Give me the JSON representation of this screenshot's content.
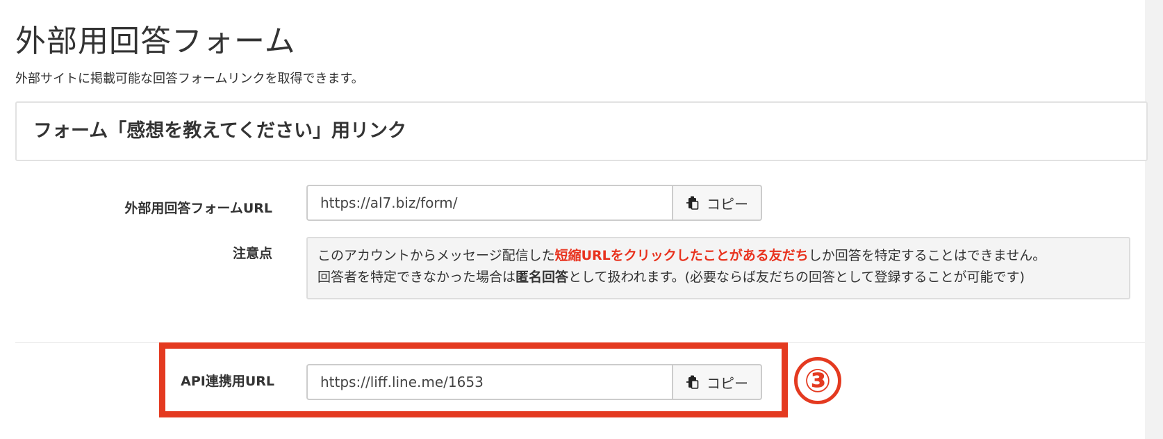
{
  "page": {
    "title": "外部用回答フォーム",
    "subtitle": "外部サイトに掲載可能な回答フォームリンクを取得できます。"
  },
  "panel": {
    "title": "フォーム「感想を教えてください」用リンク"
  },
  "external_url_row": {
    "label": "外部用回答フォームURL",
    "value": "https://al7.biz/form/",
    "copy_label": "コピー",
    "copy_icon": "clipboard-copy-icon"
  },
  "notice_row": {
    "label": "注意点",
    "line1_pre": "このアカウントからメッセージ配信した",
    "line1_highlight": "短縮URLをクリックしたことがある友だち",
    "line1_post": "しか回答を特定することはできません。",
    "line2_pre": "回答者を特定できなかった場合は",
    "line2_strong": "匿名回答",
    "line2_post": "として扱われます。(必要ならば友だちの回答として登録することが可能です)"
  },
  "api_url_row": {
    "label": "API連携用URL",
    "value": "https://liff.line.me/1653",
    "copy_label": "コピー",
    "copy_icon": "clipboard-copy-icon"
  },
  "annotation": {
    "step_marker": "③"
  },
  "colors": {
    "highlight_red": "#e43a20",
    "notice_red": "#e8321e",
    "text": "#333333",
    "notice_bg": "#f4f4f4"
  }
}
